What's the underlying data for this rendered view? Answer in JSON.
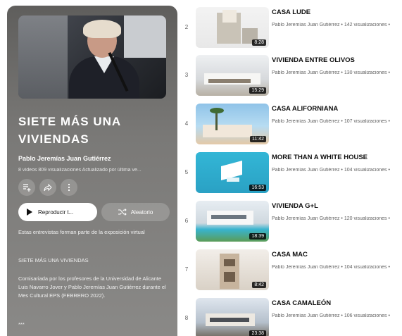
{
  "playlist": {
    "title": "SIETE MÁS UNA VIVIENDAS",
    "author": "Pablo Jeremías Juan Gutiérrez",
    "stats": "8 vídeos  809 visualizaciones  Actualizado por última ve...",
    "play_label": "Reproducir t...",
    "shuffle_label": "Aleatorio",
    "description": [
      "Estas entrevistas forman parte de la exposición virtual",
      "SIETE MÁS UNA VIVIENDAS",
      "Comisariada por los profesores de la Universidad de Alicante Luis Navarro Jover y Pablo Jeremías Juan Gutiérrez durante el Mes Cultural EPS (FEBRERO 2022).",
      "***"
    ]
  },
  "videos": [
    {
      "index": "2",
      "title": "CASA LUDE",
      "meta": "Pablo Jeremías Juan Gutiérrez • 142 visualizaciones •",
      "duration": "8:28"
    },
    {
      "index": "3",
      "title": "VIVIENDA ENTRE OLIVOS",
      "meta": "Pablo Jeremías Juan Gutiérrez • 130 visualizaciones •",
      "duration": "15:29"
    },
    {
      "index": "4",
      "title": "CASA ALIFORNIANA",
      "meta": "Pablo Jeremías Juan Gutiérrez • 107 visualizaciones •",
      "duration": "11:42"
    },
    {
      "index": "5",
      "title": "MORE THAN A WHITE HOUSE",
      "meta": "Pablo Jeremías Juan Gutiérrez • 104 visualizaciones •",
      "duration": "16:53"
    },
    {
      "index": "6",
      "title": "VIVIENDA G+L",
      "meta": "Pablo Jeremías Juan Gutiérrez • 120 visualizaciones •",
      "duration": "18:39"
    },
    {
      "index": "7",
      "title": "CASA MAC",
      "meta": "Pablo Jeremías Juan Gutiérrez • 104 visualizaciones •",
      "duration": "8:42"
    },
    {
      "index": "8",
      "title": "CASA CAMALEÓN",
      "meta": "Pablo Jeremías Juan Gutiérrez • 106 visualizaciones •",
      "duration": "23:38"
    }
  ],
  "icons": {
    "save": "playlist-add-icon",
    "share": "share-icon",
    "more": "more-vert-icon",
    "play": "play-icon",
    "shuffle": "shuffle-icon"
  }
}
